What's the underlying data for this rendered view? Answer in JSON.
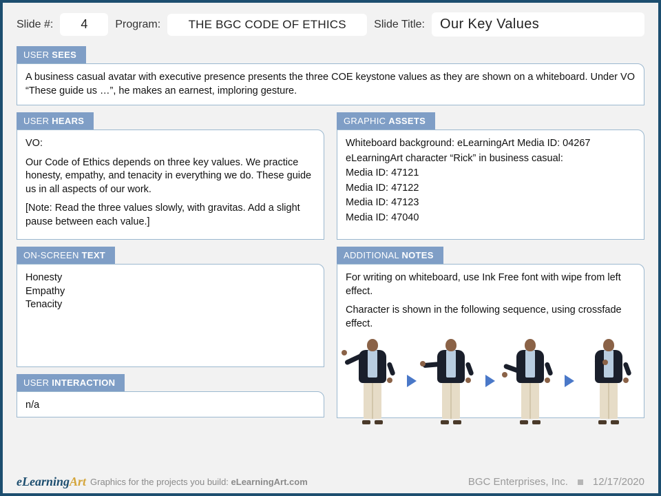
{
  "header": {
    "slide_num_label": "Slide #:",
    "slide_num": "4",
    "program_label": "Program:",
    "program": "THE BGC CODE OF ETHICS",
    "title_label": "Slide Title:",
    "title": "Our Key Values"
  },
  "sections": {
    "user_sees": {
      "tab_prefix": "USER ",
      "tab_bold": "SEES",
      "body": "A business casual avatar with executive presence presents the three COE keystone values as they are shown on a whiteboard. Under VO “These guide us …”, he makes an earnest, imploring gesture."
    },
    "user_hears": {
      "tab_prefix": "USER ",
      "tab_bold": "HEARS",
      "vo_label": "VO:",
      "vo_body": "Our Code of Ethics depends on three key values. We practice honesty, empathy, and tenacity in everything we do. These guide us in all aspects of our work.",
      "note": "[Note: Read the three values slowly, with gravitas. Add a slight pause between each value.]"
    },
    "graphic_assets": {
      "tab_prefix": "GRAPHIC ",
      "tab_bold": "ASSETS",
      "lines": [
        "Whiteboard background: eLearningArt Media ID: 04267",
        "eLearningArt character “Rick” in business casual:",
        "Media ID: 47121",
        "Media ID: 47122",
        "Media ID: 47123",
        "Media ID: 47040"
      ]
    },
    "on_screen_text": {
      "tab_prefix": "ON-SCREEN ",
      "tab_bold": "TEXT",
      "lines": [
        "Honesty",
        "Empathy",
        "Tenacity"
      ]
    },
    "additional_notes": {
      "tab_prefix": "ADDITIONAL ",
      "tab_bold": "NOTES",
      "p1": "For writing on whiteboard, use Ink Free font with wipe from left effect.",
      "p2": "Character is shown in the following sequence, using crossfade effect."
    },
    "user_interaction": {
      "tab_prefix": "USER ",
      "tab_bold": "INTERACTION",
      "body": "n/a"
    }
  },
  "footer": {
    "tagline_prefix": "Graphics for the projects you build: ",
    "tagline_bold": "eLearningArt.com",
    "company": "BGC Enterprises, Inc.",
    "date": "12/17/2020"
  }
}
